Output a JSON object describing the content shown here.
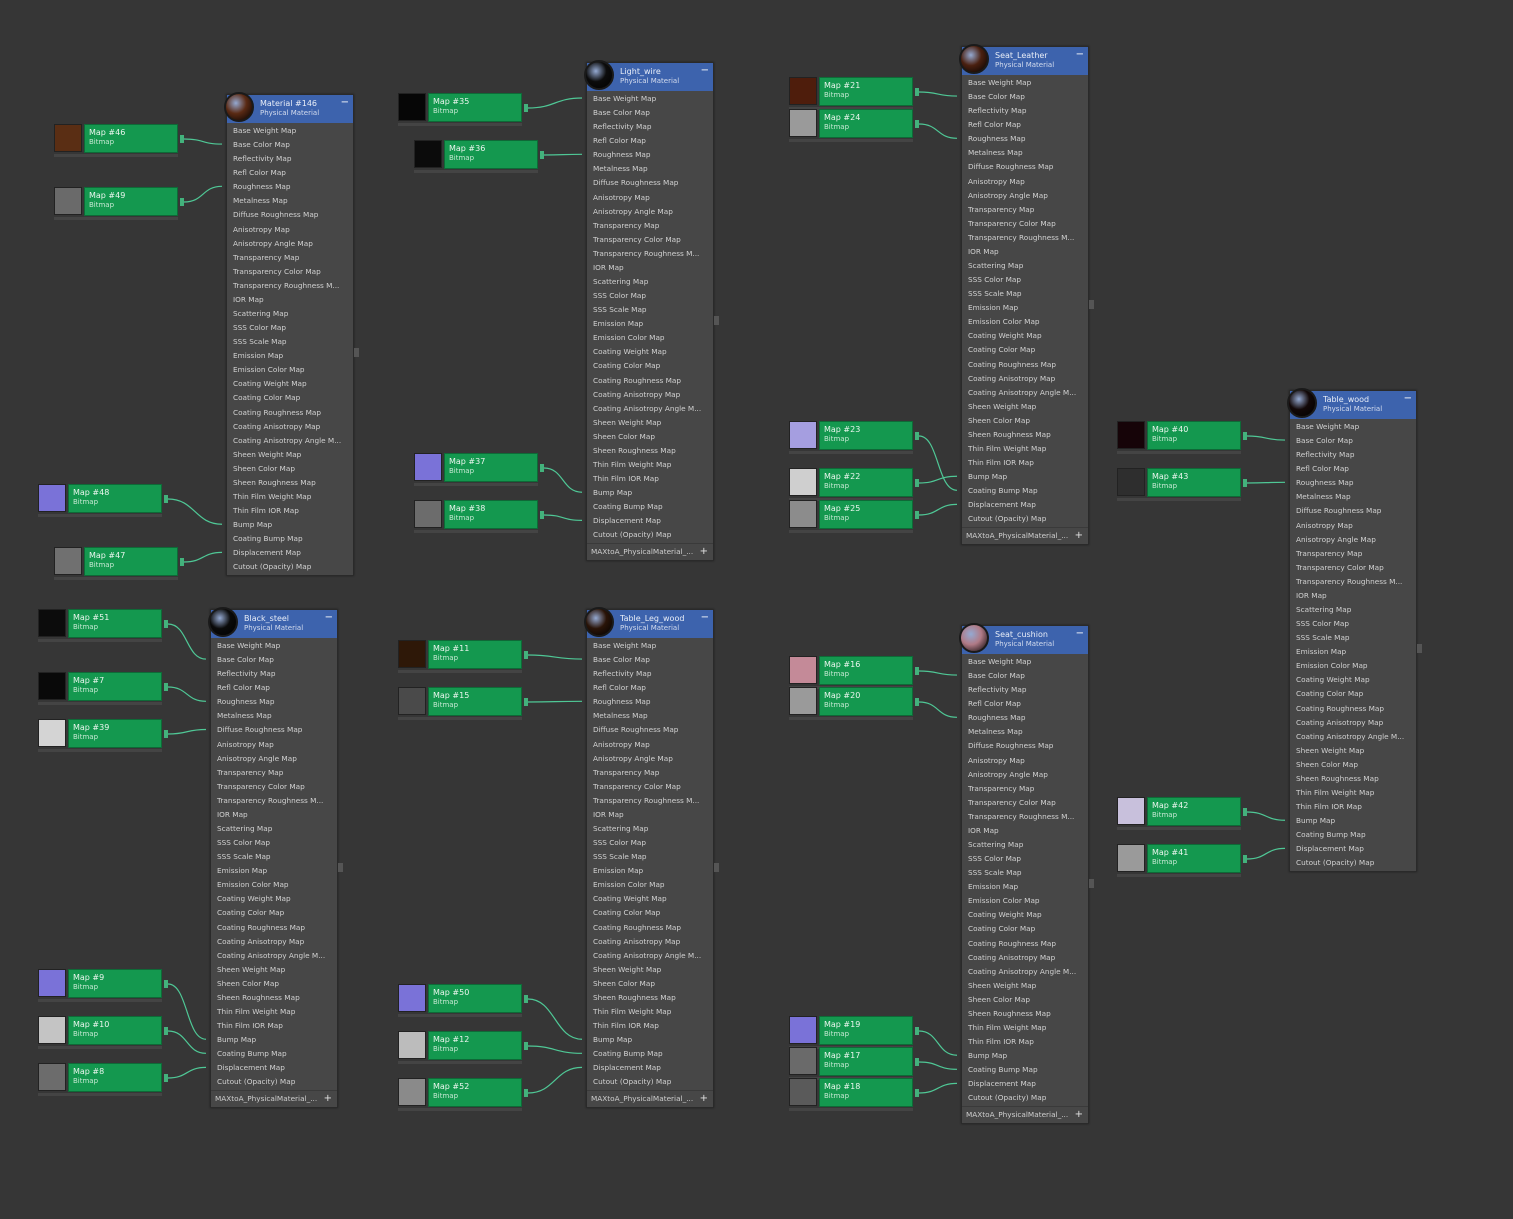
{
  "slots_standard": [
    "Base Weight Map",
    "Base Color Map",
    "Reflectivity Map",
    "Refl Color Map",
    "Roughness Map",
    "Metalness Map",
    "Diffuse Roughness Map",
    "Anisotropy Map",
    "Anisotropy Angle Map",
    "Transparency Map",
    "Transparency Color Map",
    "Transparency Roughness M...",
    "IOR Map",
    "Scattering Map",
    "SSS Color Map",
    "SSS Scale Map",
    "Emission Map",
    "Emission Color Map",
    "Coating Weight Map",
    "Coating Color Map",
    "Coating Roughness Map",
    "Coating Anisotropy Map",
    "Coating Anisotropy Angle M...",
    "Sheen Weight Map",
    "Sheen Color Map",
    "Sheen Roughness Map",
    "Thin Film Weight Map",
    "Thin Film IOR Map",
    "Bump Map",
    "Coating Bump Map",
    "Displacement Map",
    "Cutout (Opacity) Map"
  ],
  "materials": [
    {
      "name": "Material #146",
      "type": "Physical Material",
      "ball_color": "#5a2a14",
      "footer": ""
    },
    {
      "name": "Light_wire",
      "type": "Physical Material",
      "ball_color": "#0c0c0c",
      "footer": "MAXtoA_PhysicalMaterial_..."
    },
    {
      "name": "Seat_Leather",
      "type": "Physical Material",
      "ball_color": "#4a2010",
      "footer": "MAXtoA_PhysicalMaterial_..."
    },
    {
      "name": "Table_wood",
      "type": "Physical Material",
      "ball_color": "#120808",
      "footer": ""
    },
    {
      "name": "Black_steel",
      "type": "Physical Material",
      "ball_color": "#0a0a0a",
      "footer": "MAXtoA_PhysicalMaterial_..."
    },
    {
      "name": "Table_Leg_wood",
      "type": "Physical Material",
      "ball_color": "#2a1408",
      "footer": "MAXtoA_PhysicalMaterial_..."
    },
    {
      "name": "Seat_cushion",
      "type": "Physical Material",
      "ball_color": "#b07a86",
      "footer": "MAXtoA_PhysicalMaterial_..."
    }
  ],
  "maps": [
    {
      "label": "Map #46",
      "sub": "Bitmap",
      "color": "#5a2e14"
    },
    {
      "label": "Map #49",
      "sub": "Bitmap",
      "color": "#6a6a6a"
    },
    {
      "label": "Map #48",
      "sub": "Bitmap",
      "color": "#7a72d8"
    },
    {
      "label": "Map #47",
      "sub": "Bitmap",
      "color": "#707070"
    },
    {
      "label": "Map #35",
      "sub": "Bitmap",
      "color": "#060606"
    },
    {
      "label": "Map #36",
      "sub": "Bitmap",
      "color": "#0b0b0b"
    },
    {
      "label": "Map #37",
      "sub": "Bitmap",
      "color": "#7a72d8"
    },
    {
      "label": "Map #38",
      "sub": "Bitmap",
      "color": "#6c6c6c"
    },
    {
      "label": "Map #21",
      "sub": "Bitmap",
      "color": "#4e1d0c"
    },
    {
      "label": "Map #24",
      "sub": "Bitmap",
      "color": "#9a9a9a"
    },
    {
      "label": "Map #23",
      "sub": "Bitmap",
      "color": "#a59ee0"
    },
    {
      "label": "Map #22",
      "sub": "Bitmap",
      "color": "#cfcfcf"
    },
    {
      "label": "Map #25",
      "sub": "Bitmap",
      "color": "#8c8c8c"
    },
    {
      "label": "Map #40",
      "sub": "Bitmap",
      "color": "#160408"
    },
    {
      "label": "Map #43",
      "sub": "Bitmap",
      "color": "#2e2e2e"
    },
    {
      "label": "Map #42",
      "sub": "Bitmap",
      "color": "#c8c0dc"
    },
    {
      "label": "Map #41",
      "sub": "Bitmap",
      "color": "#9a9a9a"
    },
    {
      "label": "Map #51",
      "sub": "Bitmap",
      "color": "#0c0c0c"
    },
    {
      "label": "Map #7",
      "sub": "Bitmap",
      "color": "#090909"
    },
    {
      "label": "Map #39",
      "sub": "Bitmap",
      "color": "#d4d4d4"
    },
    {
      "label": "Map #9",
      "sub": "Bitmap",
      "color": "#7a72d8"
    },
    {
      "label": "Map #10",
      "sub": "Bitmap",
      "color": "#c4c4c4"
    },
    {
      "label": "Map #8",
      "sub": "Bitmap",
      "color": "#6c6c6c"
    },
    {
      "label": "Map #11",
      "sub": "Bitmap",
      "color": "#2e1808"
    },
    {
      "label": "Map #15",
      "sub": "Bitmap",
      "color": "#4a4a4a"
    },
    {
      "label": "Map #50",
      "sub": "Bitmap",
      "color": "#7a72d8"
    },
    {
      "label": "Map #12",
      "sub": "Bitmap",
      "color": "#bcbcbc"
    },
    {
      "label": "Map #52",
      "sub": "Bitmap",
      "color": "#8a8a8a"
    },
    {
      "label": "Map #16",
      "sub": "Bitmap",
      "color": "#c48a98"
    },
    {
      "label": "Map #20",
      "sub": "Bitmap",
      "color": "#9a9a9a"
    },
    {
      "label": "Map #19",
      "sub": "Bitmap",
      "color": "#7a72d8"
    },
    {
      "label": "Map #17",
      "sub": "Bitmap",
      "color": "#6a6a6a"
    },
    {
      "label": "Map #18",
      "sub": "Bitmap",
      "color": "#5a5a5a"
    }
  ],
  "icons": {
    "minimize": "minimize-icon",
    "add": "add-icon"
  },
  "colors": {
    "canvas": "#363636",
    "header": "#3d63ad",
    "map_node": "#14984f",
    "wire": "#4fc896"
  }
}
